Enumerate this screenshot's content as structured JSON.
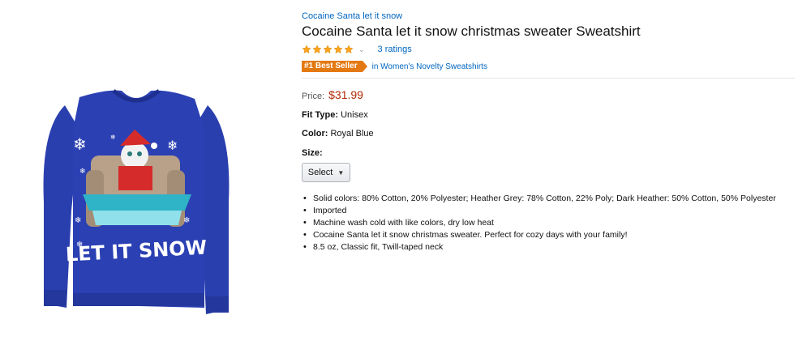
{
  "product": {
    "brand": "Cocaine Santa let it snow",
    "title": "Cocaine Santa let it snow christmas sweater Sweatshirt",
    "rating_stars": 5,
    "ratings_count": "3 ratings",
    "best_seller_badge": "#1 Best Seller",
    "best_seller_category": "in Women's Novelty Sweatshirts",
    "image": {
      "sweater_color": "#2a3fae",
      "sweater_text": "LET IT SNOW"
    }
  },
  "price": {
    "label": "Price:",
    "value": "$31.99"
  },
  "fit": {
    "label": "Fit Type:",
    "value": "Unisex"
  },
  "color": {
    "label": "Color:",
    "value": "Royal Blue"
  },
  "size": {
    "label": "Size:",
    "selected": "Select"
  },
  "bullets": [
    "Solid colors: 80% Cotton, 20% Polyester; Heather Grey: 78% Cotton, 22% Poly; Dark Heather: 50% Cotton, 50% Polyester",
    "Imported",
    "Machine wash cold with like colors, dry low heat",
    "Cocaine Santa let it snow christmas sweater. Perfect for cozy days with your family!",
    "8.5 oz, Classic fit, Twill-taped neck"
  ],
  "colors": {
    "link": "#0066c0",
    "price": "#b12704",
    "badge": "#e47911",
    "star": "#ffa41c"
  },
  "icons": {
    "star": "star-icon",
    "chevron": "chevron-down-icon"
  }
}
